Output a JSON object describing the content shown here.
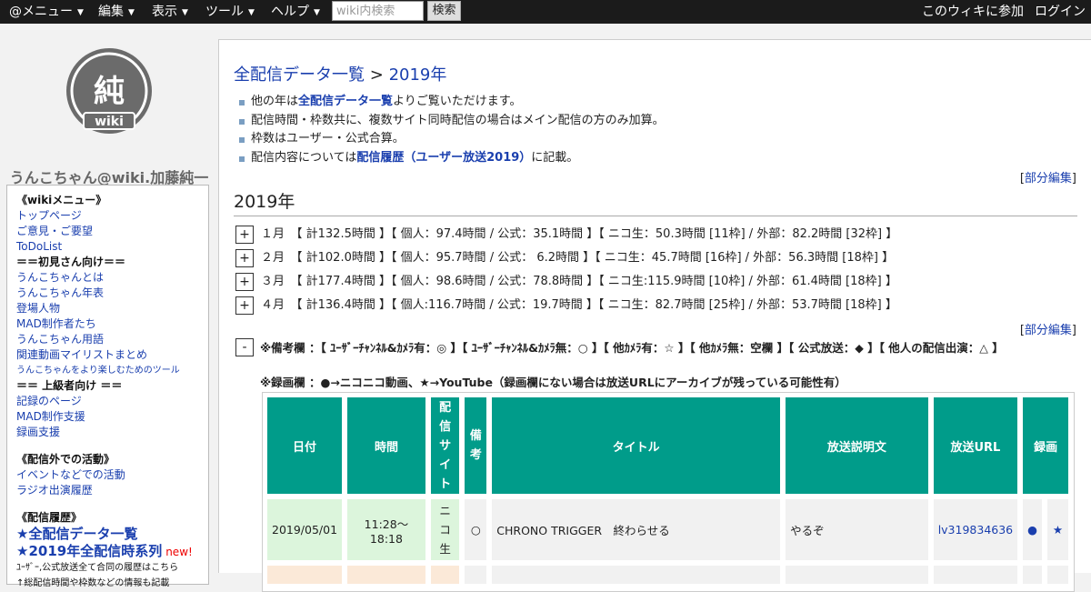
{
  "topbar": {
    "menus": [
      "@メニュー",
      "編集",
      "表示",
      "ツール",
      "ヘルプ"
    ],
    "search_placeholder": "wiki内検索",
    "search_button": "検索",
    "join": "このウィキに参加",
    "login": "ログイン"
  },
  "sidebar": {
    "logo_char": "純",
    "logo_word": "wiki",
    "site_title": "うんこちゃん@wiki.加藤純一",
    "menu_header": "《wikiメニュー》",
    "links1": [
      "トップページ",
      "ご意見・ご要望",
      "ToDoList"
    ],
    "beginner_header": "＝＝初見さん向け＝＝",
    "links2": [
      "うんこちゃんとは",
      "うんこちゃん年表",
      "登場人物",
      "MAD制作者たち",
      "うんこちゃん用語",
      "関連動画マイリストまとめ"
    ],
    "small_link": "うんこちゃんをより楽しむためのツール",
    "advanced_header": "＝＝ 上級者向け ＝＝",
    "links3": [
      "記録のページ",
      "MAD制作支援",
      "録画支援"
    ],
    "offline_header": "《配信外での活動》",
    "links4": [
      "イベントなどでの活動",
      "ラジオ出演履歴"
    ],
    "history_header": "《配信履歴》",
    "big_link1": "★全配信データ一覧",
    "big_link2": "★2019年全配信時系列",
    "new_badge": "new!",
    "note": "ﾕｰｻﾞｰ,公式放送全て合同の履歴はこちら",
    "note2": "↑総配信時間や枠数などの情報も記載"
  },
  "main": {
    "breadcrumb_link1": "全配信データ一覧",
    "breadcrumb_sep": ">",
    "breadcrumb_link2": "2019年",
    "bullets": [
      {
        "pre": "他の年は",
        "link": "全配信データ一覧",
        "post": "よりご覧いただけます。"
      },
      {
        "pre": "配信時間・枠数共に、複数サイト同時配信の場合はメイン配信の方のみ加算。",
        "link": "",
        "post": ""
      },
      {
        "pre": "枠数はユーザー・公式合算。",
        "link": "",
        "post": ""
      },
      {
        "pre": "配信内容については",
        "link": "配信履歴（ユーザー放送2019）",
        "post": "に記載。"
      }
    ],
    "edit_open": "[",
    "edit_label": "部分編集",
    "edit_close": "]",
    "heading": "2019年",
    "months": [
      {
        "toggle": "+",
        "text": "１月　【 計132.5時間 】【 個人：97.4時間 / 公式：35.1時間 】【 ニコ生：50.3時間 [11枠] / 外部：82.2時間 [32枠] 】"
      },
      {
        "toggle": "+",
        "text": "２月　【 計102.0時間 】【 個人：95.7時間 / 公式： 6.2時間 】【 ニコ生：45.7時間 [16枠] / 外部：56.3時間 [18枠] 】"
      },
      {
        "toggle": "+",
        "text": "３月　【 計177.4時間 】【 個人：98.6時間 / 公式：78.8時間 】【 ニコ生:115.9時間 [10枠] / 外部：61.4時間 [18枠] 】"
      },
      {
        "toggle": "+",
        "text": "４月　【 計136.4時間 】【 個人:116.7時間 / 公式：19.7時間 】【 ニコ生：82.7時間 [25枠] / 外部：53.7時間 [18枠] 】"
      }
    ],
    "legend_toggle": "-",
    "legend1": "※備考欄 ：【 ﾕｰｻﾞｰﾁｬﾝﾈﾙ&ｶﾒﾗ有：◎ 】【 ﾕｰｻﾞｰﾁｬﾝﾈﾙ&ｶﾒﾗ無：○ 】【 他ｶﾒﾗ有：☆ 】【 他ｶﾒﾗ無：空欄 】【 公式放送：◆ 】【 他人の配信出演：△ 】",
    "legend2": "※録画欄 ：●→ニコニコ動画、★→YouTube（録画欄にない場合は放送URLにアーカイブが残っている可能性有）"
  },
  "table": {
    "headers": [
      "日付",
      "時間",
      "配信サイト",
      "備考",
      "タイトル",
      "放送説明文",
      "放送URL",
      "録画"
    ],
    "rows": [
      {
        "date": "2019/05/01",
        "time": "11:28～18:18",
        "site": "ニコ生",
        "note": "○",
        "title": "CHRONO TRIGGER　終わらせる",
        "desc": "やるぞ",
        "url": "lv319834636",
        "rec1": "●",
        "rec2": "★"
      }
    ]
  },
  "colors": {
    "header_bg": "#009c8a",
    "row_green": "#dcf5dc",
    "topbar": "#1b1b1b",
    "link": "#1a3fae"
  }
}
